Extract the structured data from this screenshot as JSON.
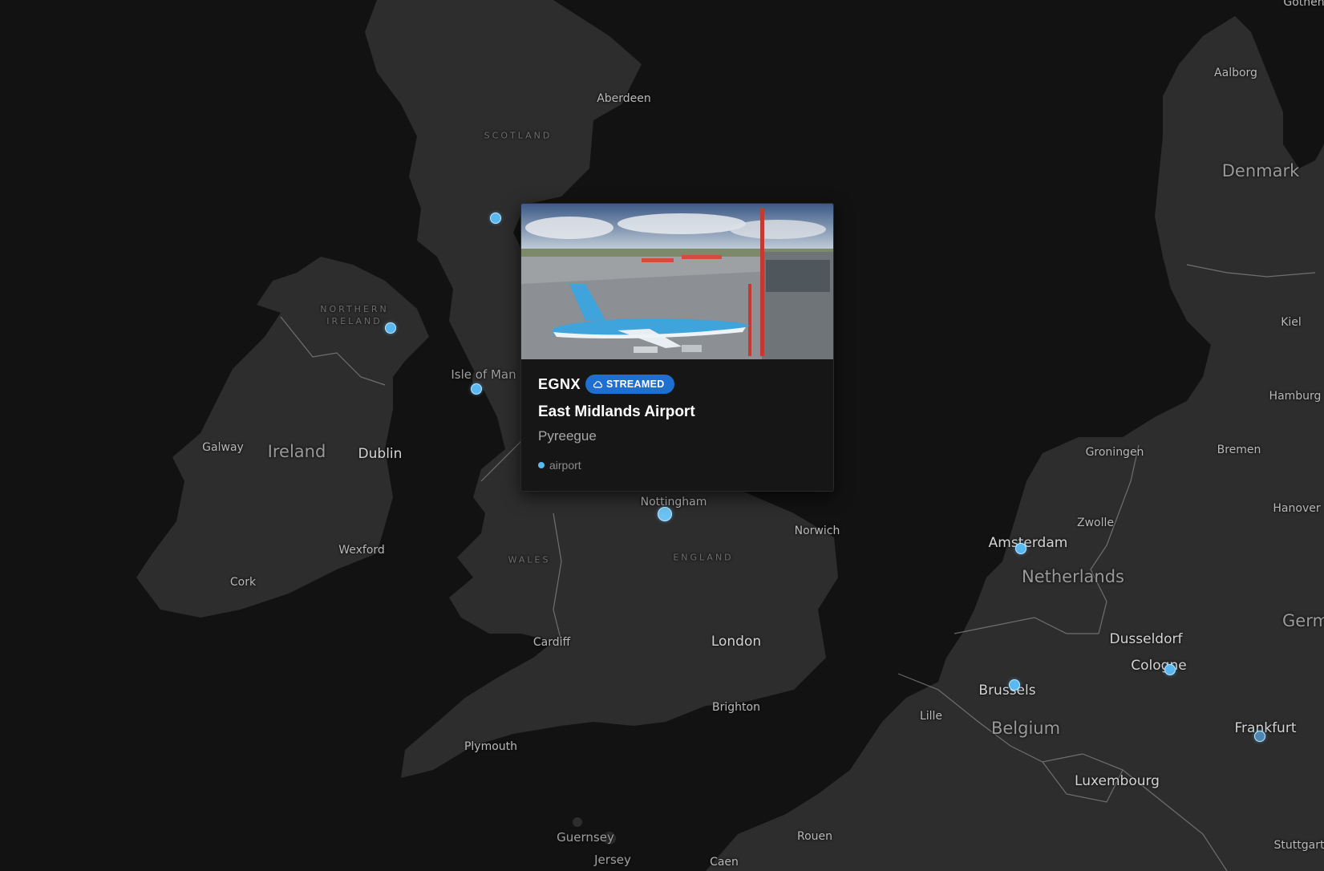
{
  "map": {
    "colors": {
      "sea": "#121212",
      "land": "#2f2f2f",
      "border": "#8a8a8a",
      "pin": "#59b8ef"
    },
    "labels": [
      {
        "id": "aberdeen",
        "text": "Aberdeen",
        "kind": "city"
      },
      {
        "id": "scotland",
        "text": "SCOTLAND",
        "kind": "region"
      },
      {
        "id": "northern-ireland",
        "text": "NORTHERN IRELAND",
        "kind": "region"
      },
      {
        "id": "isle-of-man",
        "text": "Isle of Man",
        "kind": "sea"
      },
      {
        "id": "galway",
        "text": "Galway",
        "kind": "city"
      },
      {
        "id": "ireland",
        "text": "Ireland",
        "kind": "country"
      },
      {
        "id": "dublin",
        "text": "Dublin",
        "kind": "capital"
      },
      {
        "id": "wexford",
        "text": "Wexford",
        "kind": "city"
      },
      {
        "id": "cork",
        "text": "Cork",
        "kind": "city"
      },
      {
        "id": "nottingham",
        "text": "Nottingham",
        "kind": "city"
      },
      {
        "id": "norwich",
        "text": "Norwich",
        "kind": "city"
      },
      {
        "id": "wales",
        "text": "WALES",
        "kind": "region"
      },
      {
        "id": "england",
        "text": "ENGLAND",
        "kind": "region"
      },
      {
        "id": "cardiff",
        "text": "Cardiff",
        "kind": "city"
      },
      {
        "id": "london",
        "text": "London",
        "kind": "capital"
      },
      {
        "id": "brighton",
        "text": "Brighton",
        "kind": "city"
      },
      {
        "id": "plymouth",
        "text": "Plymouth",
        "kind": "city"
      },
      {
        "id": "guernsey",
        "text": "Guernsey",
        "kind": "sea"
      },
      {
        "id": "jersey",
        "text": "Jersey",
        "kind": "sea"
      },
      {
        "id": "rouen",
        "text": "Rouen",
        "kind": "city"
      },
      {
        "id": "caen",
        "text": "Caen",
        "kind": "city"
      },
      {
        "id": "aalborg",
        "text": "Aalborg",
        "kind": "city"
      },
      {
        "id": "denmark",
        "text": "Denmark",
        "kind": "country"
      },
      {
        "id": "kiel",
        "text": "Kiel",
        "kind": "city"
      },
      {
        "id": "hamburg",
        "text": "Hamburg",
        "kind": "city"
      },
      {
        "id": "bremen",
        "text": "Bremen",
        "kind": "city"
      },
      {
        "id": "groningen",
        "text": "Groningen",
        "kind": "city"
      },
      {
        "id": "hanover",
        "text": "Hanover",
        "kind": "city"
      },
      {
        "id": "zwolle",
        "text": "Zwolle",
        "kind": "city"
      },
      {
        "id": "amsterdam",
        "text": "Amsterdam",
        "kind": "capital"
      },
      {
        "id": "netherlands",
        "text": "Netherlands",
        "kind": "country"
      },
      {
        "id": "dusseldorf",
        "text": "Dusseldorf",
        "kind": "capital"
      },
      {
        "id": "cologne",
        "text": "Cologne",
        "kind": "capital"
      },
      {
        "id": "brussels",
        "text": "Brussels",
        "kind": "capital"
      },
      {
        "id": "lille",
        "text": "Lille",
        "kind": "city"
      },
      {
        "id": "belgium",
        "text": "Belgium",
        "kind": "country"
      },
      {
        "id": "frankfurt",
        "text": "Frankfurt",
        "kind": "capital"
      },
      {
        "id": "luxembourg",
        "text": "Luxembourg",
        "kind": "capital"
      },
      {
        "id": "stuttgart",
        "text": "Stuttgart",
        "kind": "city"
      },
      {
        "id": "germany",
        "text": "Germ",
        "kind": "country"
      },
      {
        "id": "gothenburg",
        "text": "Gothen",
        "kind": "city"
      }
    ]
  },
  "popup": {
    "icao": "EGNX",
    "badge": "STREAMED",
    "badge_icon": "cloud-stream-icon",
    "badge_color": "#1e6fd0",
    "name": "East Midlands Airport",
    "author": "Pyreegue",
    "type": "airport"
  }
}
